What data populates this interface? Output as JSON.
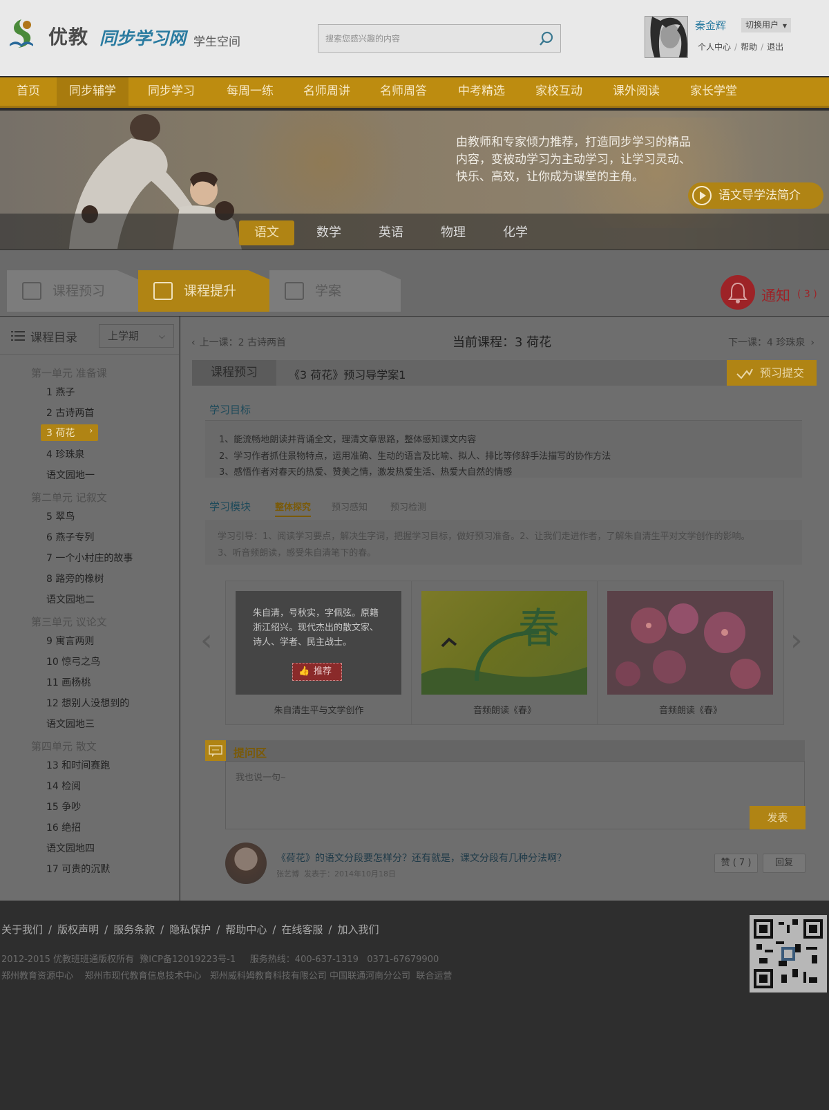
{
  "header": {
    "logo_main": "优教",
    "logo_sync": "同步学习网",
    "logo_space": "学生空间",
    "search_placeholder": "搜索您感兴趣的内容",
    "user_name": "秦金辉",
    "switch_user": "切换用户",
    "links": [
      "个人中心",
      "帮助",
      "退出"
    ]
  },
  "nav": {
    "items": [
      "首页",
      "同步辅学",
      "同步学习",
      "每周一练",
      "名师周讲",
      "名师周答",
      "中考精选",
      "家校互动",
      "课外阅读",
      "家长学堂"
    ],
    "active_index": 1
  },
  "banner": {
    "text": "由教师和专家倾力推荐，打造同步学习的精品内容，变被动学习为主动学习，让学习灵动、快乐、高效，让你成为课堂的主角。",
    "guide_button": "语文导学法简介",
    "subjects": [
      "语文",
      "数学",
      "英语",
      "物理",
      "化学"
    ],
    "active_subject": 0
  },
  "course_tabs": {
    "items": [
      "课程预习",
      "课程提升",
      "学案"
    ],
    "active_index": 1
  },
  "notice": {
    "label": "通知",
    "count": "( 3 )"
  },
  "sidebar": {
    "title": "课程目录",
    "term": "上学期",
    "tree": [
      {
        "unit": "第一单元 准备课",
        "items": [
          "1 燕子",
          "2 古诗两首",
          "3 荷花",
          "4 珍珠泉",
          "语文园地一"
        ]
      },
      {
        "unit": "第二单元 记叙文",
        "items": [
          "5 翠鸟",
          "6 燕子专列",
          "7 一个小村庄的故事",
          "8 路旁的橡树",
          "语文园地二"
        ]
      },
      {
        "unit": "第三单元 议论文",
        "items": [
          "9 寓言两则",
          "10 惊弓之鸟",
          "11 画杨桃",
          "12 想别人没想到的",
          "语文园地三"
        ]
      },
      {
        "unit": "第四单元 散文",
        "items": [
          "13 和时间赛跑",
          "14 检阅",
          "15 争吵",
          "16 绝招",
          "语文园地四",
          "17 可贵的沉默"
        ]
      }
    ],
    "active_item": "3 荷花"
  },
  "lesson": {
    "prev": "上一课：2 古诗两首",
    "current": "当前课程：3 荷花",
    "next": "下一课：4 珍珠泉",
    "preview_label": "课程预习",
    "doc_title": "《3 荷花》预习导学案1",
    "submit": "预习提交",
    "objectives_title": "学习目标",
    "objectives": [
      "1、能流畅地朗读并背诵全文，理清文章思路，整体感知课文内容",
      "2、学习作者抓住景物特点，运用准确、生动的语言及比喻、拟人、排比等修辞手法描写的协作方法",
      "3、感悟作者对春天的热爱、赞美之情，激发热爱生活、热爱大自然的情感"
    ],
    "module_title": "学习模块",
    "module_tabs": [
      "整体探究",
      "预习感知",
      "预习检测"
    ],
    "active_module": 0,
    "guide_lines": [
      "学习引导：1、阅读学习要点，解决生字词，把握学习目标，做好预习准备。2、让我们走进作者，了解朱自清生平对文学创作的影响。",
      "3、听音频朗读，感受朱自清笔下的春。"
    ]
  },
  "carousel": {
    "cards": [
      {
        "caption": "朱自清生平与文学创作",
        "overlay": "朱自清，号秋实，字佩弦。原籍浙江绍兴。现代杰出的散文家、诗人、学者、民主战士。",
        "badge": "推荐"
      },
      {
        "caption": "音频朗读《春》",
        "overlay": "春"
      },
      {
        "caption": "音频朗读《春》"
      }
    ]
  },
  "qa": {
    "title": "提问区",
    "placeholder": "我也说一句~",
    "send": "发表",
    "comment_text": "《荷花》的语文分段要怎样分？还有就是，课文分段有几种分法啊？",
    "comment_author": "张艺博",
    "comment_date": "发表于：2014年10月18日",
    "like": "赞 ( 7 )",
    "reply": "回复"
  },
  "footer": {
    "links": [
      "关于我们",
      "版权声明",
      "服务条款",
      "隐私保护",
      "帮助中心",
      "在线客服",
      "加入我们"
    ],
    "copyright": "2012-2015 优教班班通版权所有  豫ICP备12019223号-1     服务热线：400-637-1319   0371-67679900",
    "partners": "郑州教育资源中心    郑州市现代教育信息技术中心   郑州威科姆教育科技有限公司 中国联通河南分公司  联合运营"
  },
  "colors": {
    "accent": "#b08414",
    "link": "#2a7ba0",
    "notice": "#9d2327"
  }
}
